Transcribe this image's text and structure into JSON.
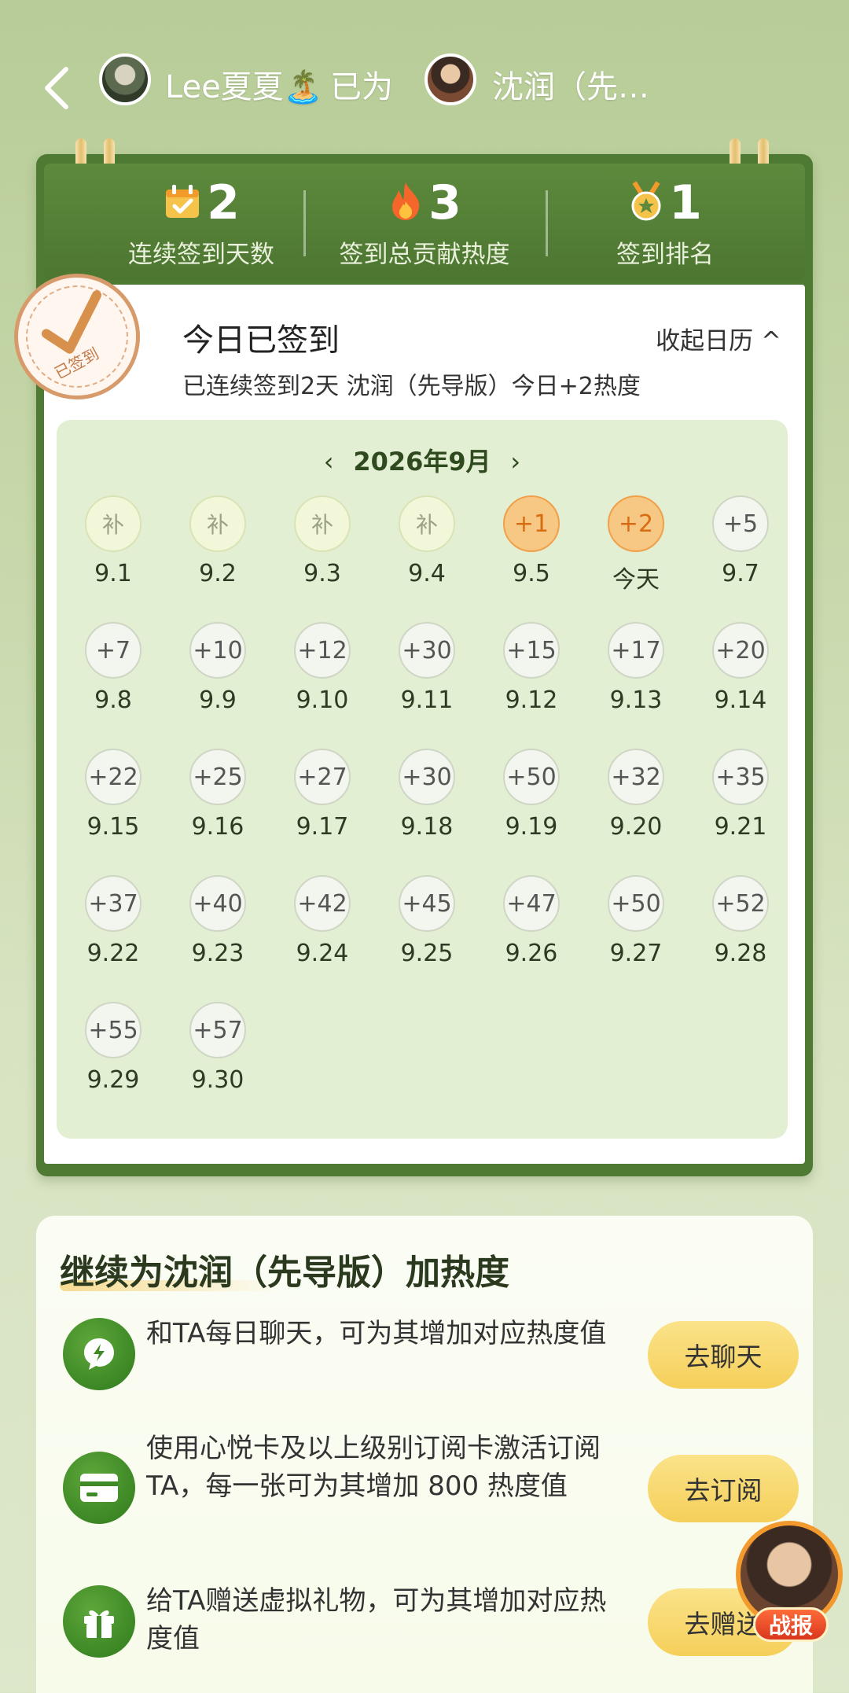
{
  "header": {
    "user_name": "Lee夏夏🏝️",
    "verb": "已为",
    "target_name": "沈润（先…"
  },
  "stats": [
    {
      "value": "2",
      "label": "连续签到天数",
      "icon": "calendar-check-icon"
    },
    {
      "value": "3",
      "label": "签到总贡献热度",
      "icon": "flame-icon"
    },
    {
      "value": "1",
      "label": "签到排名",
      "icon": "medal-icon"
    }
  ],
  "stamp": {
    "text": "已签到"
  },
  "today": {
    "title": "今日已签到",
    "subtitle": "已连续签到2天 沈润（先导版）今日+2热度",
    "collapse_label": "收起日历 ^"
  },
  "calendar": {
    "month_label": "2026年9月",
    "prev": "‹",
    "next": "›",
    "days": [
      {
        "badge": "补",
        "date": "9.1",
        "state": "makeup"
      },
      {
        "badge": "补",
        "date": "9.2",
        "state": "makeup"
      },
      {
        "badge": "补",
        "date": "9.3",
        "state": "makeup"
      },
      {
        "badge": "补",
        "date": "9.4",
        "state": "makeup"
      },
      {
        "badge": "+1",
        "date": "9.5",
        "state": "done"
      },
      {
        "badge": "+2",
        "date": "今天",
        "state": "done"
      },
      {
        "badge": "+5",
        "date": "9.7",
        "state": "future"
      },
      {
        "badge": "+7",
        "date": "9.8",
        "state": "future"
      },
      {
        "badge": "+10",
        "date": "9.9",
        "state": "future"
      },
      {
        "badge": "+12",
        "date": "9.10",
        "state": "future"
      },
      {
        "badge": "+30",
        "date": "9.11",
        "state": "future"
      },
      {
        "badge": "+15",
        "date": "9.12",
        "state": "future"
      },
      {
        "badge": "+17",
        "date": "9.13",
        "state": "future"
      },
      {
        "badge": "+20",
        "date": "9.14",
        "state": "future"
      },
      {
        "badge": "+22",
        "date": "9.15",
        "state": "future"
      },
      {
        "badge": "+25",
        "date": "9.16",
        "state": "future"
      },
      {
        "badge": "+27",
        "date": "9.17",
        "state": "future"
      },
      {
        "badge": "+30",
        "date": "9.18",
        "state": "future"
      },
      {
        "badge": "+50",
        "date": "9.19",
        "state": "future"
      },
      {
        "badge": "+32",
        "date": "9.20",
        "state": "future"
      },
      {
        "badge": "+35",
        "date": "9.21",
        "state": "future"
      },
      {
        "badge": "+37",
        "date": "9.22",
        "state": "future"
      },
      {
        "badge": "+40",
        "date": "9.23",
        "state": "future"
      },
      {
        "badge": "+42",
        "date": "9.24",
        "state": "future"
      },
      {
        "badge": "+45",
        "date": "9.25",
        "state": "future"
      },
      {
        "badge": "+47",
        "date": "9.26",
        "state": "future"
      },
      {
        "badge": "+50",
        "date": "9.27",
        "state": "future"
      },
      {
        "badge": "+52",
        "date": "9.28",
        "state": "future"
      },
      {
        "badge": "+55",
        "date": "9.29",
        "state": "future"
      },
      {
        "badge": "+57",
        "date": "9.30",
        "state": "future"
      }
    ]
  },
  "heat": {
    "title": "继续为沈润（先导版）加热度",
    "tasks": [
      {
        "icon": "chat-bolt-icon",
        "text": "和TA每日聊天，可为其增加对应热度值",
        "button": "去聊天"
      },
      {
        "icon": "card-icon",
        "text": "使用心悦卡及以上级别订阅卡激活订阅TA，每一张可为其增加 800 热度值",
        "button": "去订阅"
      },
      {
        "icon": "gift-icon",
        "text": "给TA赠送虚拟礼物，可为其增加对应热度值",
        "button": "去赠送"
      }
    ]
  },
  "float_badge": {
    "label": "战报"
  },
  "colors": {
    "accent_green": "#4f7a34",
    "done_orange": "#f0a04a",
    "button_yellow": "#f5cf5a"
  }
}
